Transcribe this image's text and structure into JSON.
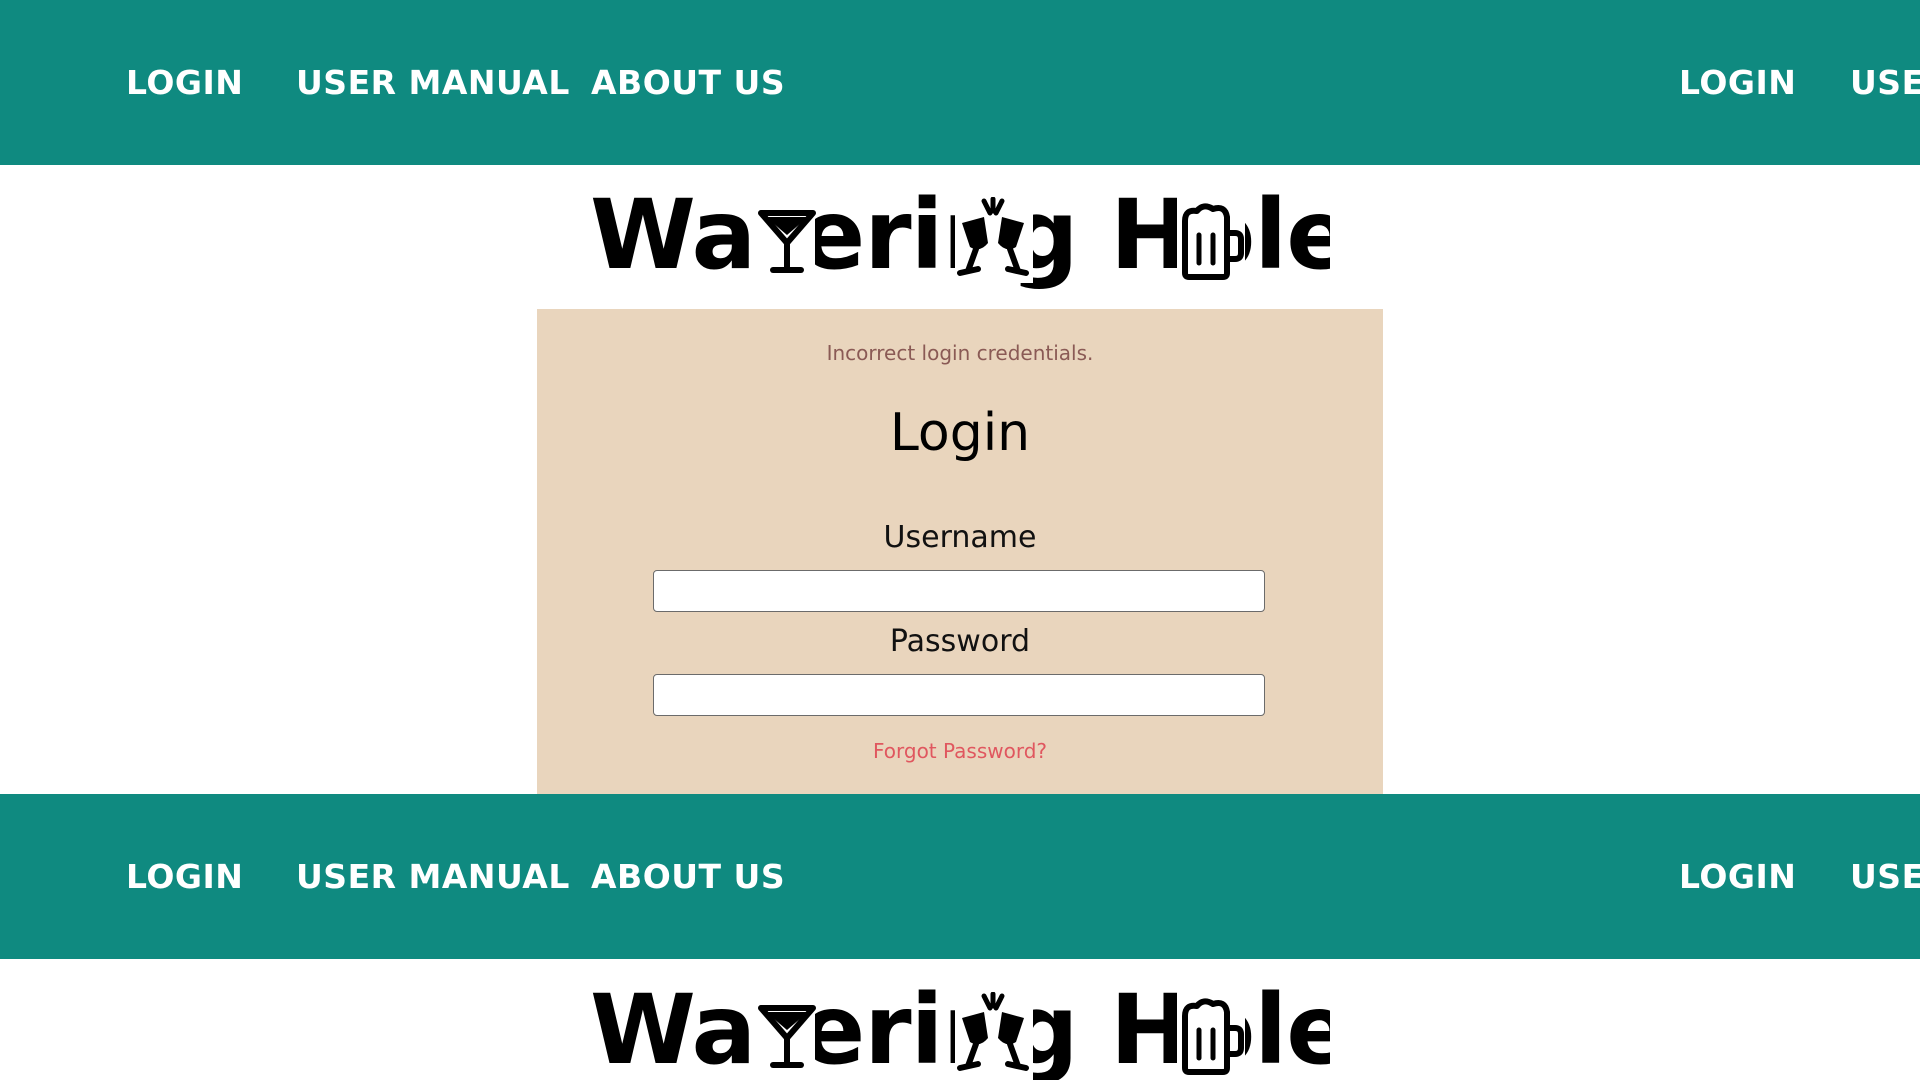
{
  "nav": {
    "links": [
      "LOGIN",
      "USER MANUAL",
      "ABOUT US"
    ],
    "repeat_links": [
      "LOGIN",
      "USE"
    ]
  },
  "logo": {
    "text": "Watering Hole",
    "icons": [
      "cocktail-glass-icon",
      "cheers-glasses-icon",
      "beer-mug-icon"
    ]
  },
  "login": {
    "error": "Incorrect login credentials.",
    "title": "Login",
    "username_label": "Username",
    "username_value": "",
    "password_label": "Password",
    "password_value": "",
    "forgot": "Forgot Password?"
  },
  "colors": {
    "nav_bg": "#0f8a80",
    "panel_bg": "#e9d5bd",
    "error_text": "#8a5a55",
    "forgot_link": "#e0575f"
  }
}
